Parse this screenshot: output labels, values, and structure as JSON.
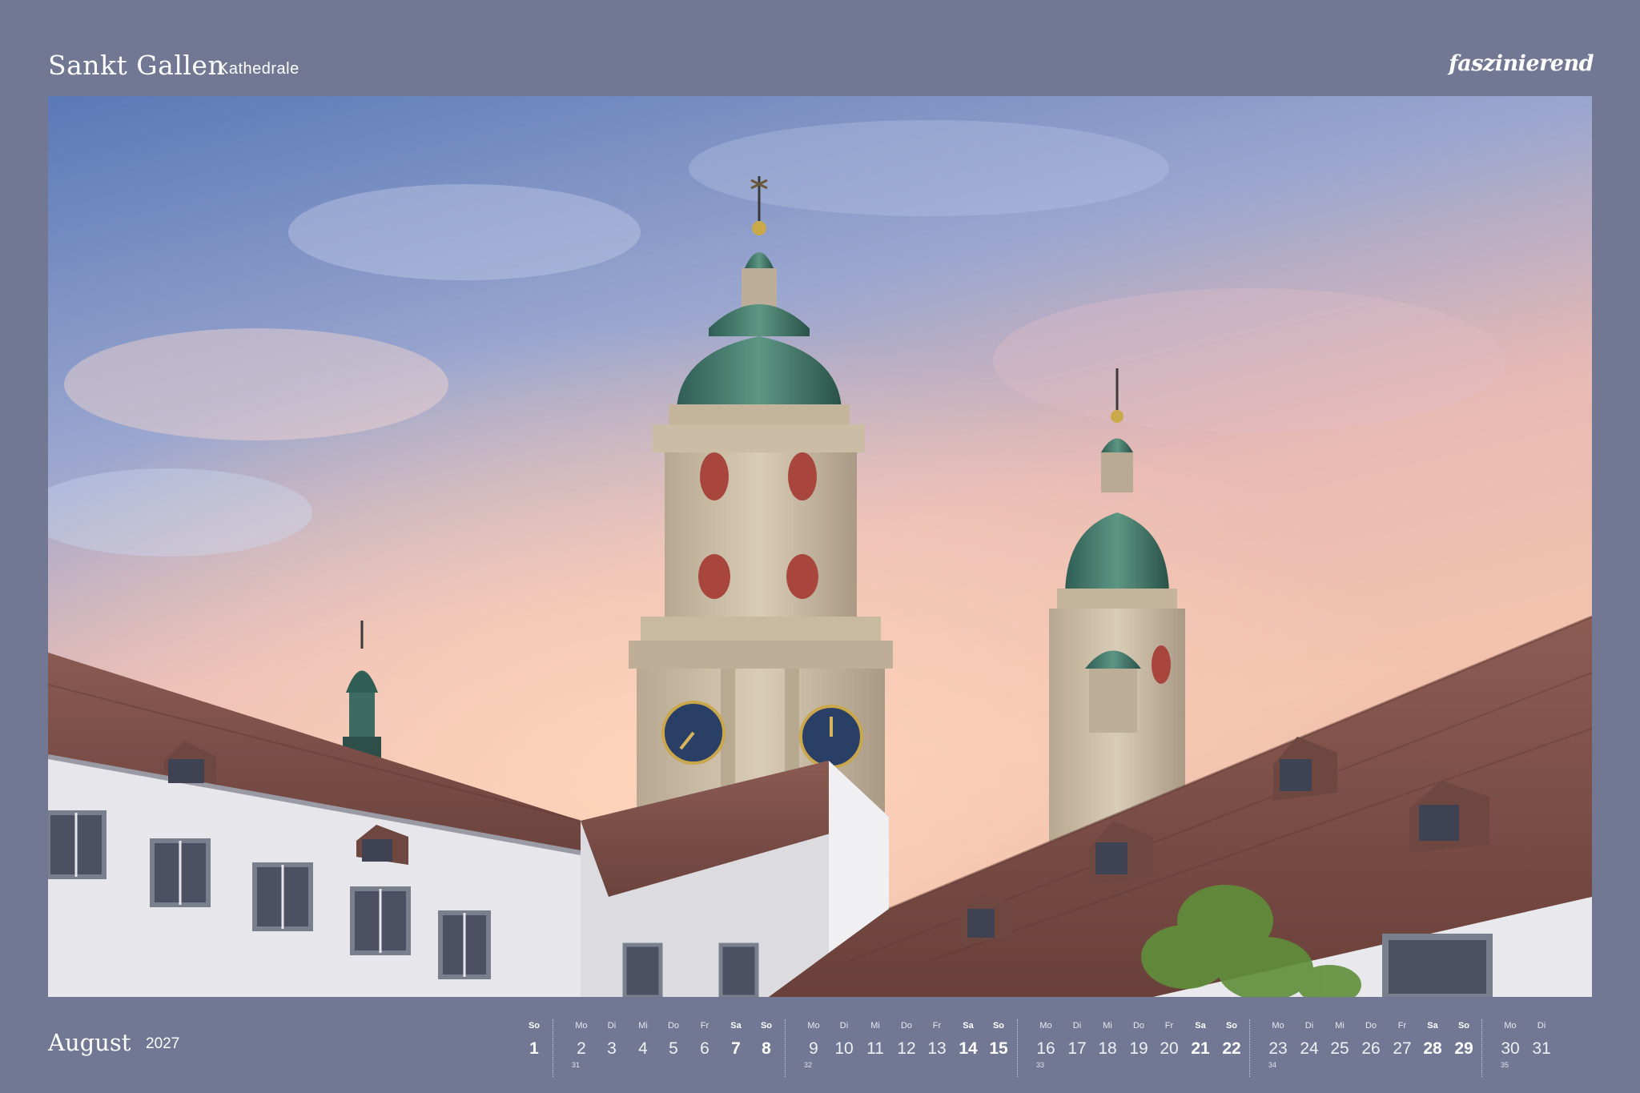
{
  "header": {
    "title": "Sankt Gallen",
    "subtitle": "Kathedrale",
    "brand": "faszinierend"
  },
  "footer": {
    "month": "August",
    "year": "2027"
  },
  "calendar": {
    "days": [
      {
        "name": "So",
        "num": "1",
        "weekend": true
      },
      {
        "name": "Mo",
        "num": "2"
      },
      {
        "name": "Di",
        "num": "3"
      },
      {
        "name": "Mi",
        "num": "4"
      },
      {
        "name": "Do",
        "num": "5"
      },
      {
        "name": "Fr",
        "num": "6"
      },
      {
        "name": "Sa",
        "num": "7",
        "weekend": true
      },
      {
        "name": "So",
        "num": "8",
        "weekend": true
      },
      {
        "name": "Mo",
        "num": "9"
      },
      {
        "name": "Di",
        "num": "10"
      },
      {
        "name": "Mi",
        "num": "11"
      },
      {
        "name": "Do",
        "num": "12"
      },
      {
        "name": "Fr",
        "num": "13"
      },
      {
        "name": "Sa",
        "num": "14",
        "weekend": true
      },
      {
        "name": "So",
        "num": "15",
        "weekend": true
      },
      {
        "name": "Mo",
        "num": "16"
      },
      {
        "name": "Di",
        "num": "17"
      },
      {
        "name": "Mi",
        "num": "18"
      },
      {
        "name": "Do",
        "num": "19"
      },
      {
        "name": "Fr",
        "num": "20"
      },
      {
        "name": "Sa",
        "num": "21",
        "weekend": true
      },
      {
        "name": "So",
        "num": "22",
        "weekend": true
      },
      {
        "name": "Mo",
        "num": "23"
      },
      {
        "name": "Di",
        "num": "24"
      },
      {
        "name": "Mi",
        "num": "25"
      },
      {
        "name": "Do",
        "num": "26"
      },
      {
        "name": "Fr",
        "num": "27"
      },
      {
        "name": "Sa",
        "num": "28",
        "weekend": true
      },
      {
        "name": "So",
        "num": "29",
        "weekend": true
      },
      {
        "name": "Mo",
        "num": "30"
      },
      {
        "name": "Di",
        "num": "31"
      }
    ],
    "weeks": [
      "31",
      "32",
      "33",
      "34",
      "35"
    ]
  },
  "colors": {
    "page": "#727893",
    "sky_top": "#5b79b6",
    "sky_glow": "#f3c3ae",
    "roof": "#7e4f48",
    "stone": "#c9b9a2",
    "copper": "#3f7a6a"
  }
}
